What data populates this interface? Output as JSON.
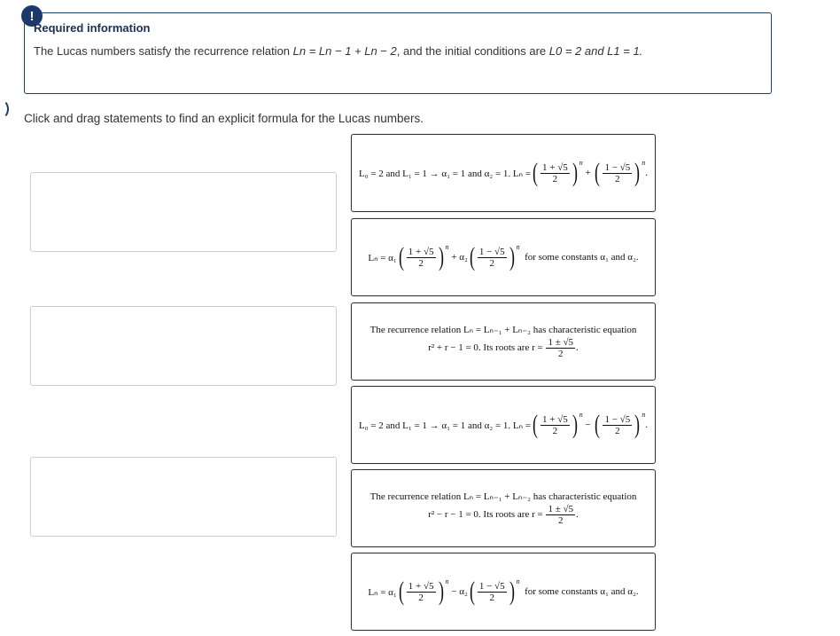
{
  "alert": {
    "icon_glyph": "!"
  },
  "info": {
    "title": "Required information",
    "text_prefix": "The Lucas numbers satisfy the recurrence relation ",
    "recurrence": "Ln = Ln − 1 + Ln − 2",
    "text_middle": ", and the initial conditions are ",
    "initial_conditions": "L0 = 2 and L1 = 1."
  },
  "instructions": "Click and drag statements to find an explicit formula for the Lucas numbers.",
  "cards": [
    {
      "lead": "L₀ = 2 and L₁ = 1 → α₁ = 1 and α₂ = 1. Lₙ =",
      "term1_num": "1 + √5",
      "term1_den": "2",
      "operator": "+",
      "term2_num": "1 − √5",
      "term2_den": "2",
      "exponent": "n",
      "tail": "."
    },
    {
      "lead": "Lₙ = α₁",
      "term1_num": "1 + √5",
      "term1_den": "2",
      "operator": "+ α₂",
      "term2_num": "1 − √5",
      "term2_den": "2",
      "exponent": "n",
      "tail": "for some constants α₁ and α₂."
    },
    {
      "line1": "The recurrence relation Lₙ = Lₙ₋₁ + Lₙ₋₂ has characteristic equation",
      "line2": "r² + r − 1 = 0. Its roots are r =",
      "root_num": "1 ± √5",
      "root_den": "2",
      "tail": "."
    },
    {
      "lead": "L₀ = 2 and L₁ = 1 → α₁ = 1 and α₂ = 1. Lₙ =",
      "term1_num": "1 + √5",
      "term1_den": "2",
      "operator": "−",
      "term2_num": "1 − √5",
      "term2_den": "2",
      "exponent": "n",
      "tail": "."
    },
    {
      "line1": "The recurrence relation Lₙ = Lₙ₋₁ + Lₙ₋₂ has characteristic equation",
      "line2": "r² − r − 1 = 0. Its roots are r =",
      "root_num": "1 ± √5",
      "root_den": "2",
      "tail": "."
    },
    {
      "lead": "Lₙ = α₁",
      "term1_num": "1 + √5",
      "term1_den": "2",
      "operator": "− α₂",
      "term2_num": "1 − √5",
      "term2_den": "2",
      "exponent": "n",
      "tail": "for some constants α₁ and α₂."
    }
  ],
  "colors": {
    "accent": "#1b3a6b",
    "border": "#1f3f6b"
  }
}
